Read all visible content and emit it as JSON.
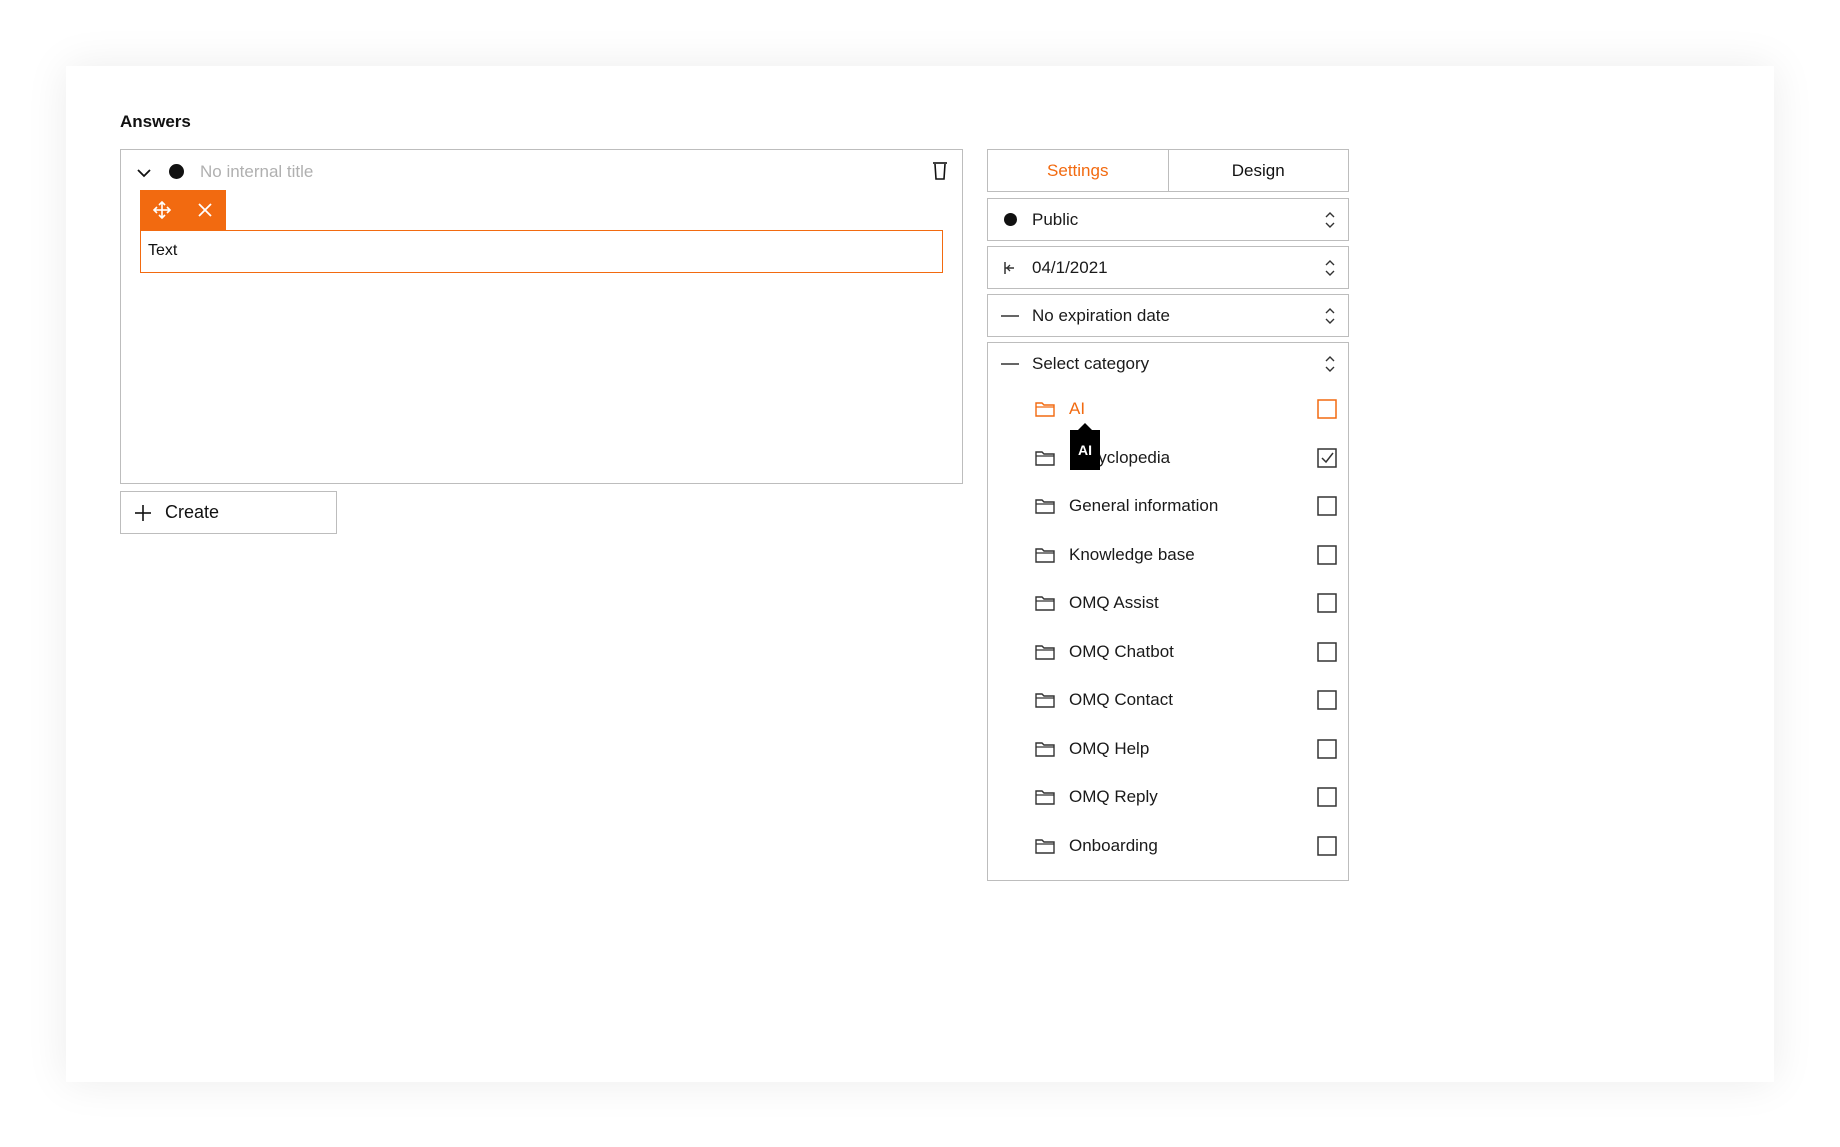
{
  "section_title": "Answers",
  "answer": {
    "internal_title_placeholder": "No internal title",
    "text_block": "Text"
  },
  "create_label": "Create",
  "tabs": [
    {
      "label": "Settings",
      "active": true
    },
    {
      "label": "Design",
      "active": false
    }
  ],
  "fields": {
    "visibility": "Public",
    "start_date": "04/1/2021",
    "expiration": "No expiration date",
    "category": "Select category"
  },
  "categories": [
    {
      "label": "AI",
      "checked": false,
      "active": true
    },
    {
      "label": "Encyclopedia",
      "checked": true,
      "active": false
    },
    {
      "label": "General information",
      "checked": false,
      "active": false
    },
    {
      "label": "Knowledge base",
      "checked": false,
      "active": false
    },
    {
      "label": "OMQ Assist",
      "checked": false,
      "active": false
    },
    {
      "label": "OMQ Chatbot",
      "checked": false,
      "active": false
    },
    {
      "label": "OMQ Contact",
      "checked": false,
      "active": false
    },
    {
      "label": "OMQ Help",
      "checked": false,
      "active": false
    },
    {
      "label": "OMQ Reply",
      "checked": false,
      "active": false
    },
    {
      "label": "Onboarding",
      "checked": false,
      "active": false
    }
  ],
  "tooltip": "AI",
  "colors": {
    "accent": "#f26a10",
    "border": "#bdbdbd"
  }
}
